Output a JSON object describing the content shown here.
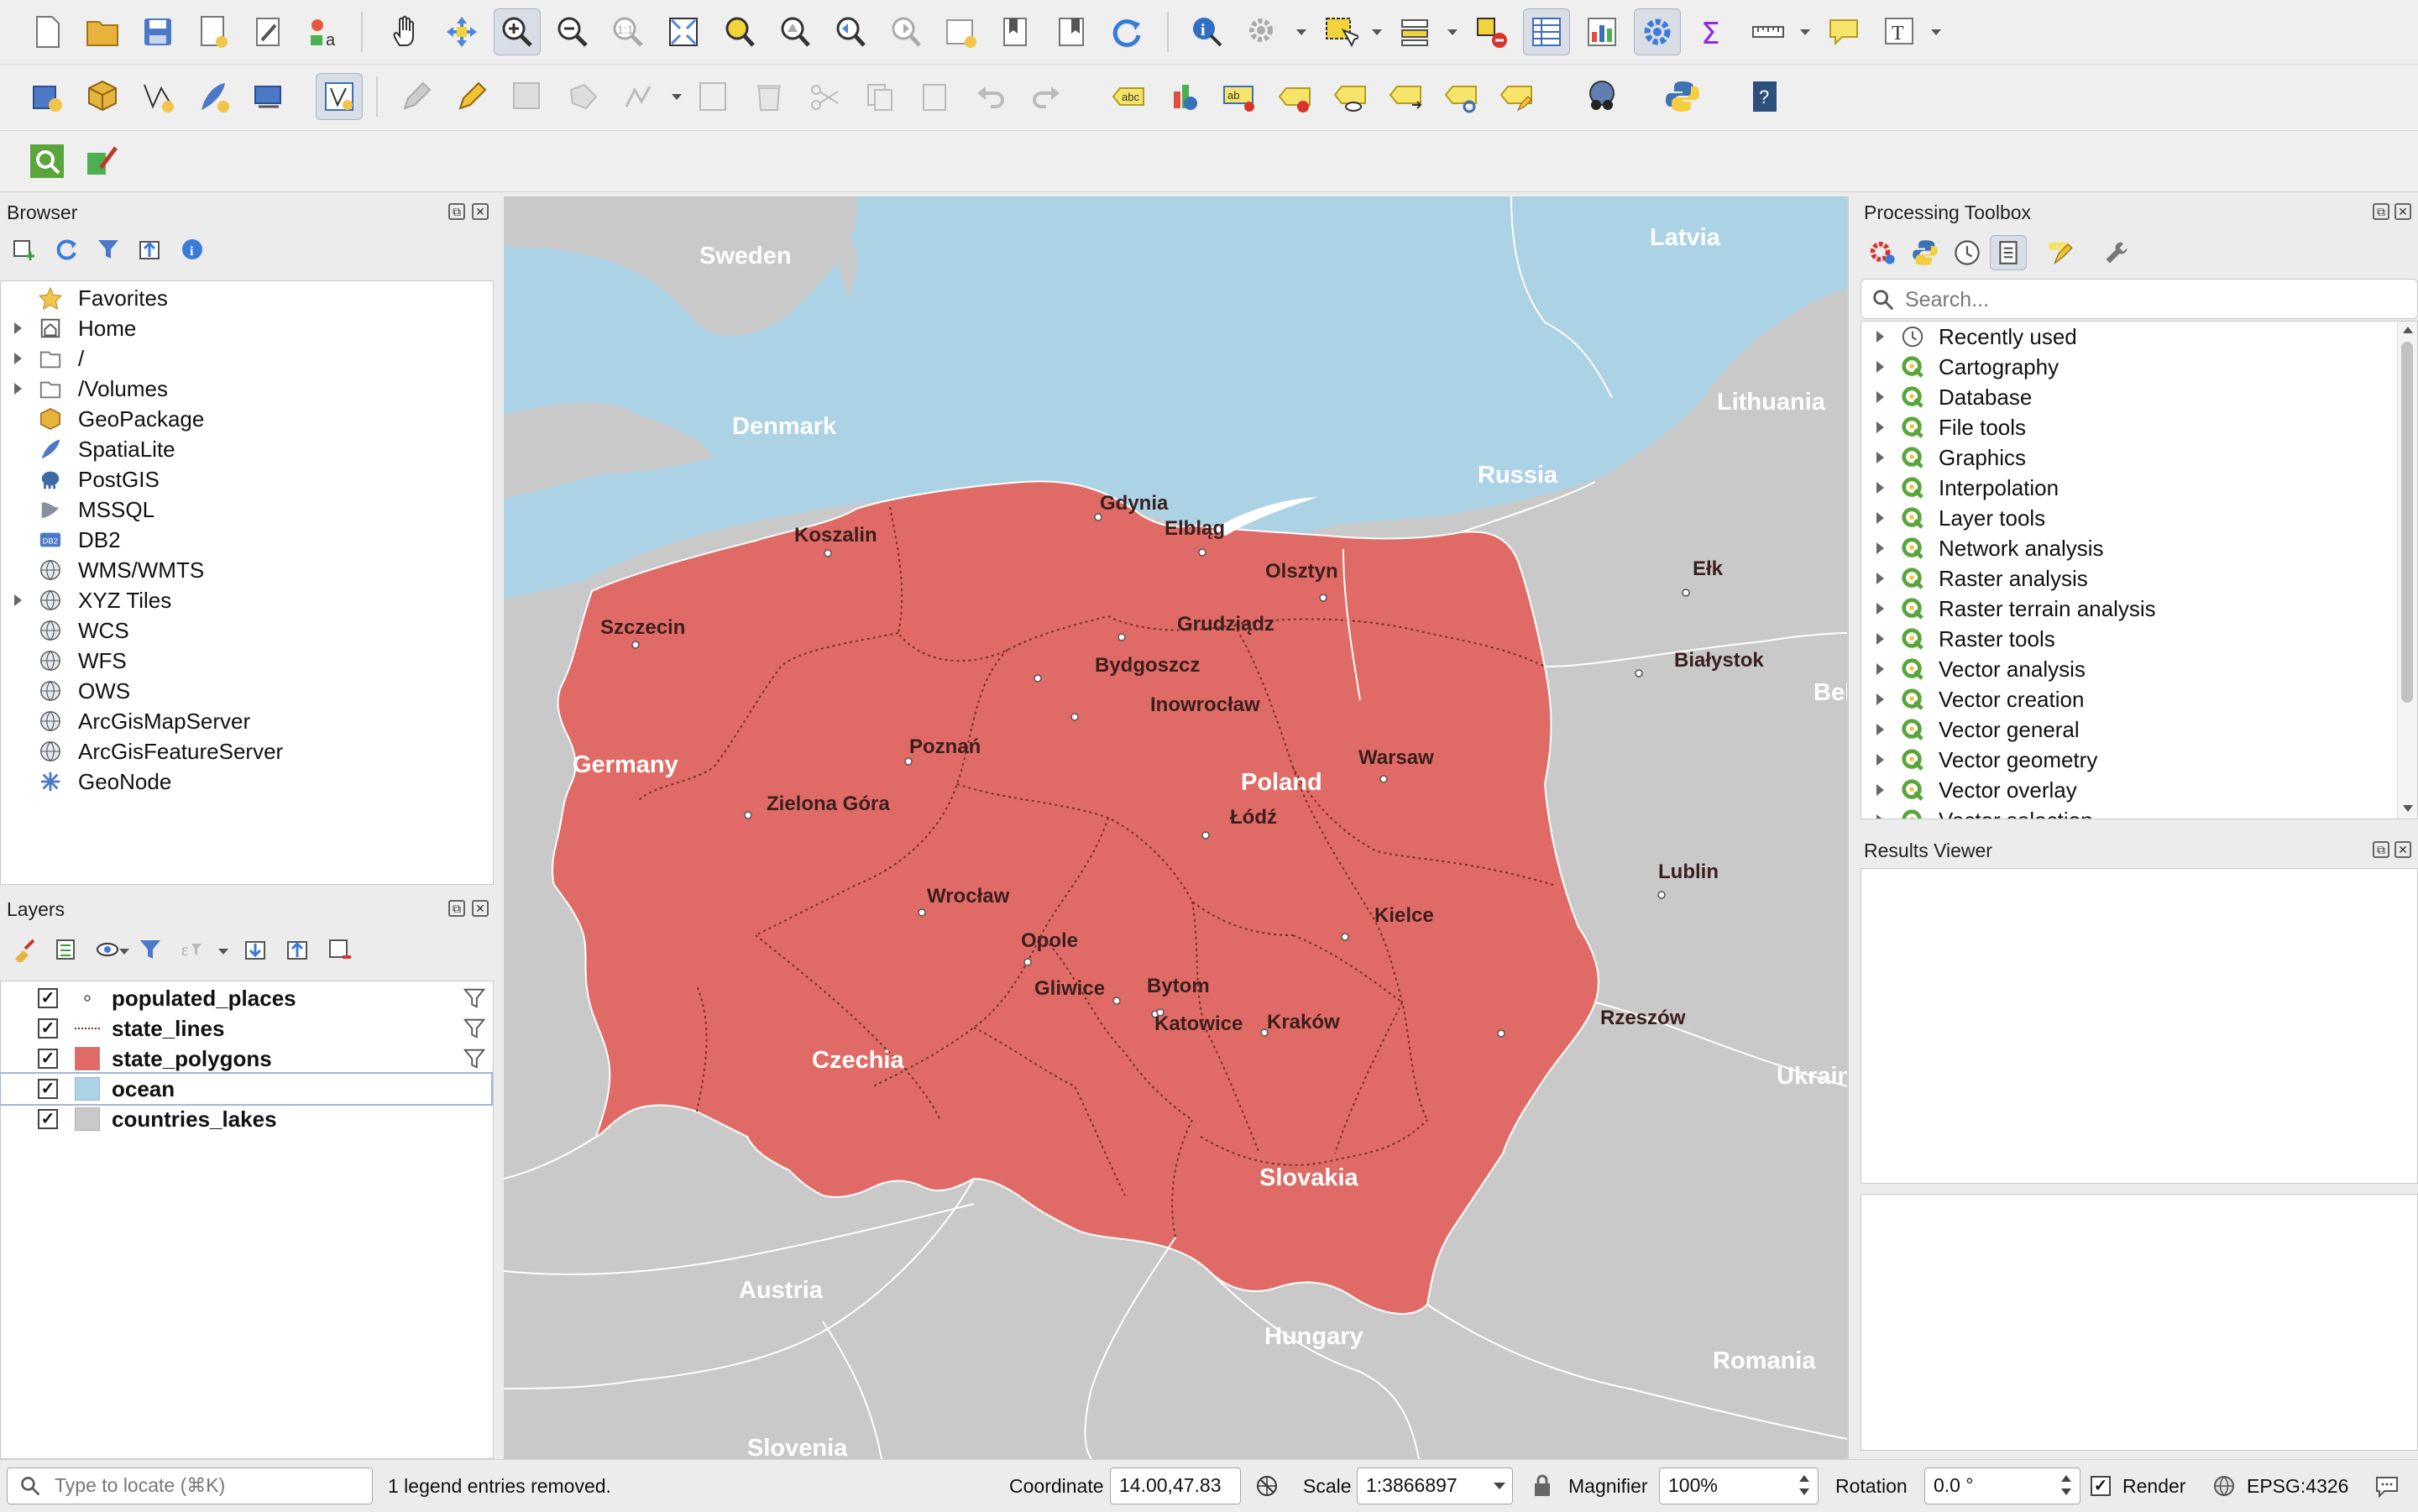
{
  "browser": {
    "title": "Browser",
    "items": [
      {
        "label": "Favorites",
        "expandable": false,
        "icon": "star-icon"
      },
      {
        "label": "Home",
        "expandable": true,
        "icon": "home-icon"
      },
      {
        "label": "/",
        "expandable": true,
        "icon": "folder-icon"
      },
      {
        "label": "/Volumes",
        "expandable": true,
        "icon": "folder-icon"
      },
      {
        "label": "GeoPackage",
        "expandable": false,
        "icon": "geopackage-icon"
      },
      {
        "label": "SpatiaLite",
        "expandable": false,
        "icon": "feather-icon"
      },
      {
        "label": "PostGIS",
        "expandable": false,
        "icon": "elephant-icon"
      },
      {
        "label": "MSSQL",
        "expandable": false,
        "icon": "mssql-icon"
      },
      {
        "label": "DB2",
        "expandable": false,
        "icon": "db2-icon"
      },
      {
        "label": "WMS/WMTS",
        "expandable": false,
        "icon": "globe-icon"
      },
      {
        "label": "XYZ Tiles",
        "expandable": true,
        "icon": "globe-icon"
      },
      {
        "label": "WCS",
        "expandable": false,
        "icon": "globe-icon"
      },
      {
        "label": "WFS",
        "expandable": false,
        "icon": "globe-icon"
      },
      {
        "label": "OWS",
        "expandable": false,
        "icon": "globe-icon"
      },
      {
        "label": "ArcGisMapServer",
        "expandable": false,
        "icon": "globe-icon"
      },
      {
        "label": "ArcGisFeatureServer",
        "expandable": false,
        "icon": "globe-icon"
      },
      {
        "label": "GeoNode",
        "expandable": false,
        "icon": "geonode-icon"
      }
    ]
  },
  "layers": {
    "title": "Layers",
    "items": [
      {
        "label": "populated_places",
        "checked": true,
        "symbol": "point",
        "filter": true,
        "selected": false
      },
      {
        "label": "state_lines",
        "checked": true,
        "symbol": "line",
        "filter": true,
        "selected": false
      },
      {
        "label": "state_polygons",
        "checked": true,
        "symbol": "fill-red",
        "filter": true,
        "selected": false
      },
      {
        "label": "ocean",
        "checked": true,
        "symbol": "fill-blue",
        "filter": false,
        "selected": true
      },
      {
        "label": "countries_lakes",
        "checked": true,
        "symbol": "fill-grey",
        "filter": false,
        "selected": false
      }
    ]
  },
  "map": {
    "country_labels": [
      "Sweden",
      "Latvia",
      "Denmark",
      "Lithuania",
      "Russia",
      "Belarus",
      "Germany",
      "Poland",
      "Czechia",
      "Ukraine",
      "Slovakia",
      "Austria",
      "Hungary",
      "Romania",
      "Slovenia"
    ],
    "city_labels": [
      "Gdynia",
      "Koszalin",
      "Elbląg",
      "Olsztyn",
      "Ełk",
      "Szczecin",
      "Grudziądz",
      "Bydgoszcz",
      "Białystok",
      "Inowrocław",
      "Poznań",
      "Warsaw",
      "Zielona Góra",
      "Łódź",
      "Lublin",
      "Wrocław",
      "Kielce",
      "Opole",
      "Gliwice",
      "Bytom",
      "Katowice",
      "Kraków",
      "Rzeszów"
    ],
    "colors": {
      "ocean": "#acd2e6",
      "land": "#c9c9c9",
      "poland": "#e06b66",
      "border": "#ffffff",
      "state_line": "#7a2d2a"
    }
  },
  "processing": {
    "title": "Processing Toolbox",
    "search_placeholder": "Search...",
    "items": [
      "Recently used",
      "Cartography",
      "Database",
      "File tools",
      "Graphics",
      "Interpolation",
      "Layer tools",
      "Network analysis",
      "Raster analysis",
      "Raster terrain analysis",
      "Raster tools",
      "Vector analysis",
      "Vector creation",
      "Vector general",
      "Vector geometry",
      "Vector overlay",
      "Vector selection"
    ]
  },
  "results": {
    "title": "Results Viewer"
  },
  "status": {
    "locate_placeholder": "Type to locate (⌘K)",
    "message": "1 legend entries removed.",
    "coordinate_label": "Coordinate",
    "coordinate_value": "14.00,47.83",
    "scale_label": "Scale",
    "scale_value": "1:3866897",
    "magnifier_label": "Magnifier",
    "magnifier_value": "100%",
    "rotation_label": "Rotation",
    "rotation_value": "0.0 °",
    "render_label": "Render",
    "crs": "EPSG:4326"
  }
}
